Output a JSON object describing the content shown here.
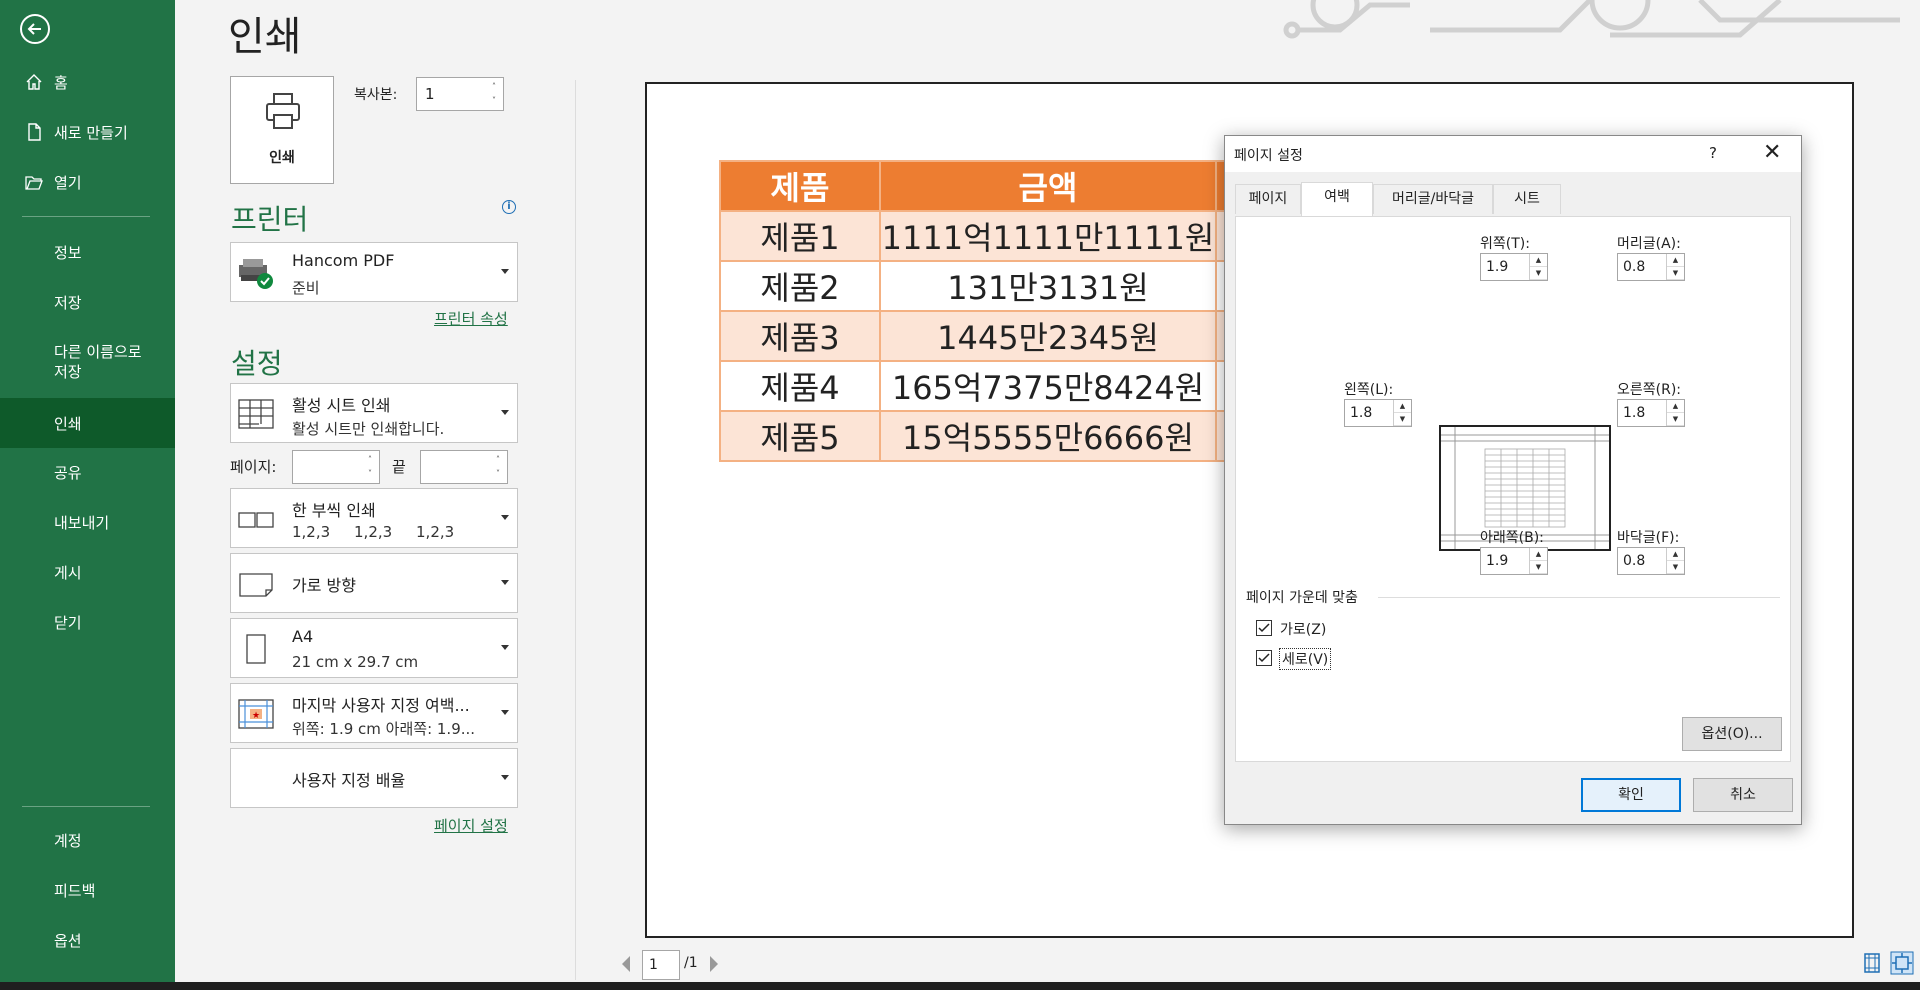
{
  "sidebar": {
    "items": {
      "home": "홈",
      "new": "새로 만들기",
      "open": "열기",
      "info": "정보",
      "save": "저장",
      "save_as": "다른 이름으로\n저장",
      "print": "인쇄",
      "share": "공유",
      "export": "내보내기",
      "publish": "게시",
      "close": "닫기",
      "account": "계정",
      "feedback": "피드백",
      "options": "옵션"
    }
  },
  "print": {
    "title": "인쇄",
    "print_button": "인쇄",
    "copies_label": "복사본:",
    "copies_value": "1",
    "printer_title": "프린터",
    "printer_name": "Hancom PDF",
    "printer_status": "준비",
    "printer_props": "프린터 속성",
    "settings_title": "설정",
    "sheet_opt": {
      "l1": "활성 시트 인쇄",
      "l2": "활성 시트만 인쇄합니다."
    },
    "pages_label": "페이지:",
    "to_label": "끝",
    "collate_opt": {
      "l1": "한 부씩 인쇄",
      "l2": "1,2,3     1,2,3     1,2,3"
    },
    "orientation_opt": "가로 방향",
    "paper_opt": {
      "l1": "A4",
      "l2": "21 cm x 29.7 cm"
    },
    "margin_opt": {
      "l1": "마지막 사용자 지정 여백...",
      "l2": "위쪽: 1.9 cm 아래쪽: 1.9..."
    },
    "scale_opt": "사용자 지정 배율",
    "page_setup_link": "페이지 설정",
    "page_current": "1",
    "page_total": "/1"
  },
  "preview": {
    "headers": [
      "제품",
      "금액"
    ],
    "rows": [
      [
        "제품1",
        "1111억1111만1111원"
      ],
      [
        "제품2",
        "131만3131원"
      ],
      [
        "제품3",
        "1445만2345원"
      ],
      [
        "제품4",
        "165억7375만8424원"
      ],
      [
        "제품5",
        "15억5555만6666원"
      ]
    ]
  },
  "dialog": {
    "title": "페이지 설정",
    "help": "?",
    "close": "✕",
    "tabs": [
      "페이지",
      "여백",
      "머리글/바닥글",
      "시트"
    ],
    "top_label": "위쪽(T):",
    "top_value": "1.9",
    "header_label": "머리글(A):",
    "header_value": "0.8",
    "left_label": "왼쪽(L):",
    "left_value": "1.8",
    "right_label": "오른쪽(R):",
    "right_value": "1.8",
    "bottom_label": "아래쪽(B):",
    "bottom_value": "1.9",
    "footer_label": "바닥글(F):",
    "footer_value": "0.8",
    "center_title": "페이지 가운데 맞춤",
    "horizontal": "가로(Z)",
    "vertical": "세로(V)",
    "options_btn": "옵션(O)...",
    "ok_btn": "확인",
    "cancel_btn": "취소"
  },
  "colors": {
    "excel_green": "#217346",
    "header_orange": "#ed7d31",
    "row_tint": "#fce4d6"
  }
}
